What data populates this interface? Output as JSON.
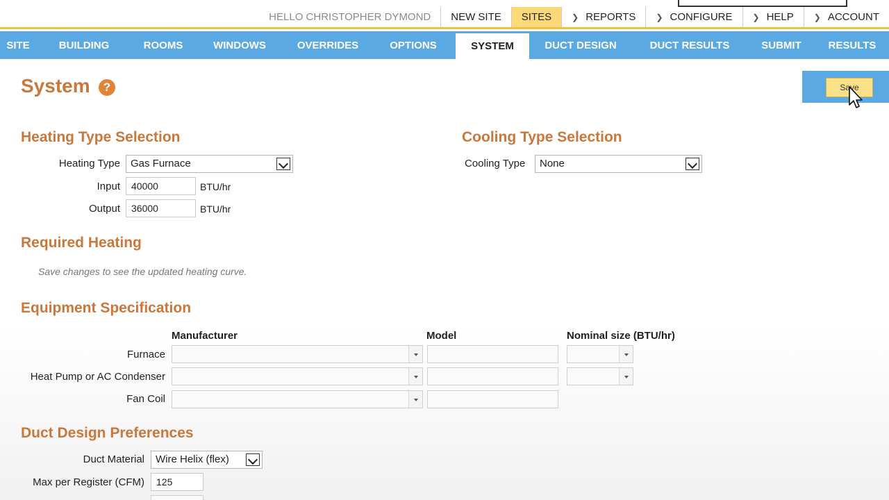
{
  "top_bar": {
    "greeting": "HELLO CHRISTOPHER DYMOND",
    "items": [
      {
        "label": "NEW SITE"
      },
      {
        "label": "SITES"
      },
      {
        "label": "REPORTS"
      },
      {
        "label": "CONFIGURE"
      },
      {
        "label": "HELP"
      },
      {
        "label": "ACCOUNT"
      }
    ]
  },
  "nav": {
    "tabs": [
      {
        "label": "SITE"
      },
      {
        "label": "BUILDING"
      },
      {
        "label": "ROOMS"
      },
      {
        "label": "WINDOWS"
      },
      {
        "label": "OVERRIDES"
      },
      {
        "label": "OPTIONS"
      },
      {
        "label": "SYSTEM"
      },
      {
        "label": "DUCT DESIGN"
      },
      {
        "label": "DUCT RESULTS"
      },
      {
        "label": "SUBMIT"
      },
      {
        "label": "RESULTS"
      }
    ],
    "active_tab": "SYSTEM"
  },
  "page": {
    "title": "System",
    "help_icon": "?",
    "save_label": "Save"
  },
  "heating": {
    "title": "Heating Type Selection",
    "type_label": "Heating Type",
    "type_value": "Gas Furnace",
    "input_label": "Input",
    "input_value": "40000",
    "output_label": "Output",
    "output_value": "36000",
    "unit": "BTU/hr"
  },
  "cooling": {
    "title": "Cooling Type Selection",
    "type_label": "Cooling Type",
    "type_value": "None"
  },
  "required_heating": {
    "title": "Required Heating",
    "note": "Save changes to see the updated heating curve."
  },
  "equipment": {
    "title": "Equipment Specification",
    "columns": {
      "manufacturer": "Manufacturer",
      "model": "Model",
      "nominal_size": "Nominal size (BTU/hr)"
    },
    "rows": [
      {
        "label": "Furnace"
      },
      {
        "label": "Heat Pump or AC Condenser"
      },
      {
        "label": "Fan Coil"
      }
    ]
  },
  "duct_prefs": {
    "title": "Duct Design Preferences",
    "material_label": "Duct Material",
    "material_value": "Wire Helix (flex)",
    "max_register_label": "Max per Register (CFM)",
    "max_register_value": "125"
  },
  "colors": {
    "nav_blue": "#5aa9e3",
    "accent_orange": "#c9773a",
    "active_yellow": "#fbd878"
  }
}
